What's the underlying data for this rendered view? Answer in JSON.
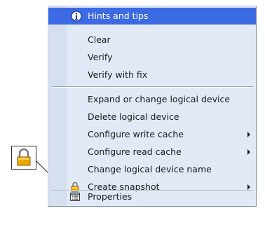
{
  "menu": {
    "items": [
      {
        "label": "Hints and tips",
        "icon": "info-icon",
        "highlighted": true
      },
      {
        "label": "Clear"
      },
      {
        "label": "Verify"
      },
      {
        "label": "Verify with fix"
      },
      {
        "label": "Expand or change logical device"
      },
      {
        "label": "Delete logical device"
      },
      {
        "label": "Configure write cache",
        "submenu": true
      },
      {
        "label": "Configure read cache",
        "submenu": true
      },
      {
        "label": "Change logical device name"
      },
      {
        "label": "Create snapshot",
        "icon": "lock-icon",
        "submenu": true
      },
      {
        "label": "Properties",
        "icon": "properties-icon"
      }
    ]
  },
  "colors": {
    "highlight": "#3b6ae3",
    "menu_background": "#e1e9f7",
    "lock_body": "#e8a800"
  }
}
